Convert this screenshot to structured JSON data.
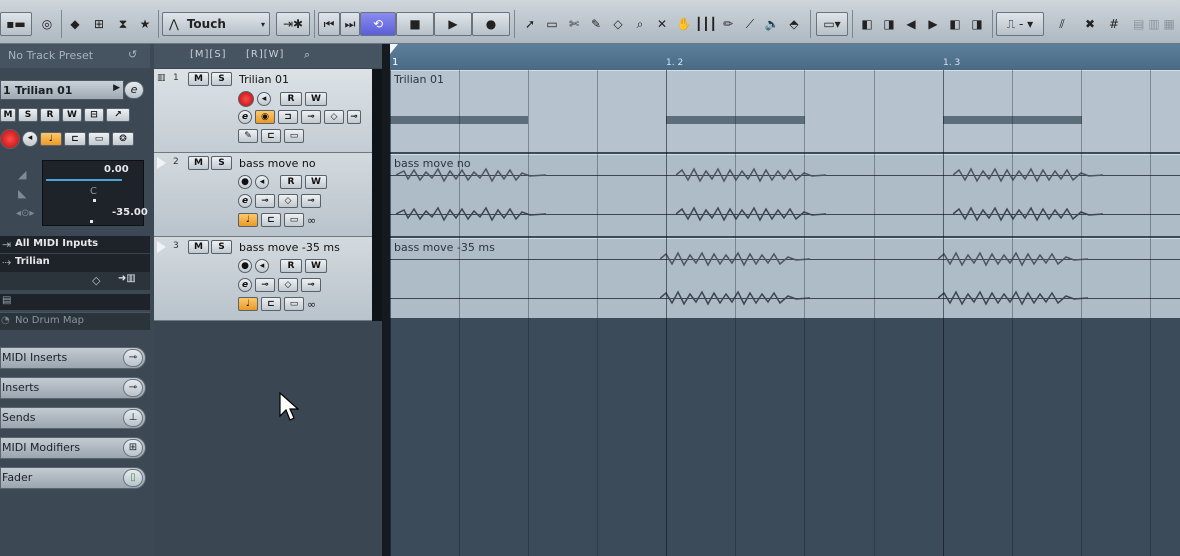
{
  "toolbar": {
    "automation_mode": "Touch",
    "transport": [
      "go-to-start",
      "go-to-end",
      "cycle",
      "stop",
      "play",
      "record"
    ],
    "tools": [
      "object-select",
      "range",
      "split",
      "glue",
      "erase",
      "zoom",
      "mute",
      "play",
      "draw",
      "line",
      "comp",
      "drumstick"
    ]
  },
  "inspector": {
    "track_preset": "No Track Preset",
    "track_index": "1",
    "track_name": "Trilian 01",
    "volume_value": "0.00",
    "pan_value": "C",
    "delay_value": "-35.00",
    "input_routing": "All MIDI Inputs",
    "output_routing": "Trilian",
    "drum_map": "No Drum Map",
    "sections": [
      {
        "label": "MIDI Inserts",
        "icon": "inserts-icon"
      },
      {
        "label": "Inserts",
        "icon": "inserts-icon"
      },
      {
        "label": "Sends",
        "icon": "sends-icon"
      },
      {
        "label": "MIDI Modifiers",
        "icon": "modifiers-icon"
      },
      {
        "label": "Fader",
        "icon": "fader-icon"
      }
    ],
    "buttons": [
      "M",
      "S",
      "R",
      "W"
    ]
  },
  "tracks": [
    {
      "number": "1",
      "name": "Trilian 01",
      "type": "instrument"
    },
    {
      "number": "2",
      "name": "bass move no",
      "type": "audio"
    },
    {
      "number": "3",
      "name": "bass move -35 ms",
      "type": "audio"
    }
  ],
  "track_buttons": {
    "mute": "M",
    "solo": "S",
    "read": "R",
    "write": "W"
  },
  "ruler": {
    "marks": [
      "1",
      "1. 2",
      "1. 3"
    ]
  },
  "parts": [
    {
      "track": "1",
      "name": "Trilian 01"
    },
    {
      "track": "2",
      "name": "bass move no"
    },
    {
      "track": "3",
      "name": "bass move -35 ms"
    }
  ],
  "colors": {
    "accent_cycle": "#5b5ed6",
    "record": "#d21818",
    "monitor": "#e89b25",
    "ruler": "#4a6a84"
  }
}
